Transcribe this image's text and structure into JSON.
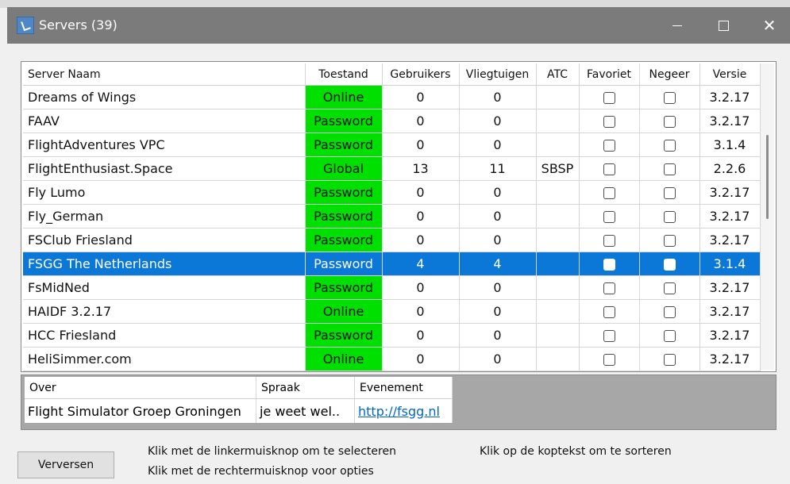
{
  "window": {
    "title": "Servers (39)"
  },
  "columns": [
    "Server Naam",
    "Toestand",
    "Gebruikers",
    "Vliegtuigen",
    "ATC",
    "Favoriet",
    "Negeer",
    "Versie"
  ],
  "rows": [
    {
      "name": "Dreams of Wings",
      "status": "Online",
      "users": "0",
      "aircraft": "0",
      "atc": "",
      "version": "3.2.17"
    },
    {
      "name": "FAAV",
      "status": "Password",
      "users": "0",
      "aircraft": "0",
      "atc": "",
      "version": "3.2.17"
    },
    {
      "name": "FlightAdventures VPC",
      "status": "Password",
      "users": "0",
      "aircraft": "0",
      "atc": "",
      "version": "3.1.4"
    },
    {
      "name": "FlightEnthusiast.Space",
      "status": "Global",
      "users": "13",
      "aircraft": "11",
      "atc": "SBSP",
      "version": "2.2.6"
    },
    {
      "name": "Fly Lumo",
      "status": "Password",
      "users": "0",
      "aircraft": "0",
      "atc": "",
      "version": "3.2.17"
    },
    {
      "name": "Fly_German",
      "status": "Password",
      "users": "0",
      "aircraft": "0",
      "atc": "",
      "version": "3.2.17"
    },
    {
      "name": "FSClub Friesland",
      "status": "Password",
      "users": "0",
      "aircraft": "0",
      "atc": "",
      "version": "3.2.17"
    },
    {
      "name": "FSGG The Netherlands",
      "status": "Password",
      "users": "4",
      "aircraft": "4",
      "atc": "",
      "version": "3.1.4",
      "selected": true
    },
    {
      "name": "FsMidNed",
      "status": "Password",
      "users": "0",
      "aircraft": "0",
      "atc": "",
      "version": "3.2.17"
    },
    {
      "name": "HAIDF 3.2.17",
      "status": "Online",
      "users": "0",
      "aircraft": "0",
      "atc": "",
      "version": "3.2.17"
    },
    {
      "name": "HCC Friesland",
      "status": "Password",
      "users": "0",
      "aircraft": "0",
      "atc": "",
      "version": "3.2.17"
    },
    {
      "name": "HeliSimmer.com",
      "status": "Online",
      "users": "0",
      "aircraft": "0",
      "atc": "",
      "version": "3.2.17"
    }
  ],
  "details": {
    "columns": [
      "Over",
      "Spraak",
      "Evenement"
    ],
    "about": "Flight Simulator Groep Groningen",
    "voice": "je weet wel..",
    "event": "http://fsgg.nl"
  },
  "footer": {
    "refresh_label": "Verversen",
    "hint_select": "Klik met de linkermuisknop om te selecteren",
    "hint_options": "Klik met de rechtermuisknop voor opties",
    "hint_sort": "Klik op de koptekst om te sorteren"
  },
  "colors": {
    "status_green": "#00e000",
    "selection_blue": "#0b78d7",
    "titlebar": "#7b7b7b"
  }
}
